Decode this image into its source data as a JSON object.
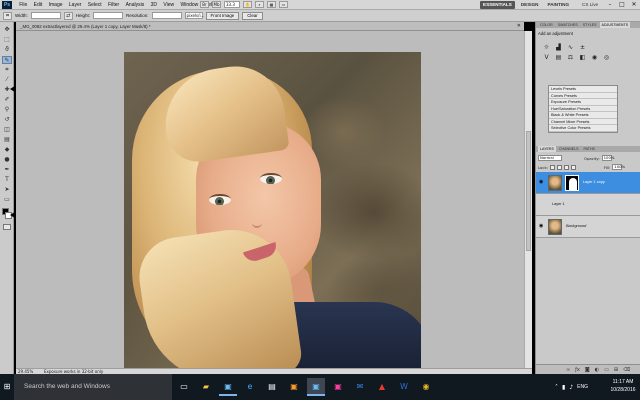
{
  "menubar": {
    "logo": "Ps",
    "items": [
      "File",
      "Edit",
      "Image",
      "Layer",
      "Select",
      "Filter",
      "Analysis",
      "3D",
      "View",
      "Window",
      "Help"
    ],
    "zoom": "33.3",
    "workspaces": [
      "ESSENTIALS",
      "DESIGN",
      "PAINTING"
    ],
    "cs_live": "CS Live"
  },
  "options": {
    "width_label": "Width:",
    "height_label": "Height:",
    "resolution_label": "Resolution:",
    "units": "pixels/i...",
    "front_image": "Front Image",
    "clear": "Clear"
  },
  "document": {
    "tab_title": "_MG_0082 extractlayered @ 29.4% (Layer 1 copy, Layer Mask/8) *",
    "status_zoom": "29.45%",
    "status_text": "Exposure works in 32-bit only"
  },
  "panels": {
    "top_tabs": [
      "COLOR",
      "SWATCHES",
      "STYLES",
      "ADJUSTMENTS"
    ],
    "adjust_header": "Add an adjustment",
    "presets": [
      "Levels Presets",
      "Curves Presets",
      "Exposure Presets",
      "Hue/Saturation Presets",
      "Black & White Presets",
      "Channel Mixer Presets",
      "Selective Color Presets"
    ],
    "layer_tabs": [
      "LAYERS",
      "CHANNELS",
      "PATHS"
    ],
    "blend_mode": "Normal",
    "opacity_label": "Opacity:",
    "opacity_value": "100%",
    "lock_label": "Lock:",
    "fill_label": "Fill:",
    "fill_value": "100%",
    "layers": [
      {
        "name": "Layer 1 copy"
      },
      {
        "name": "Layer 1"
      },
      {
        "name": "Background"
      }
    ]
  },
  "taskbar": {
    "search_placeholder": "Search the web and Windows",
    "lang": "ENG",
    "time": "11:17 AM",
    "date": "10/28/2016"
  }
}
